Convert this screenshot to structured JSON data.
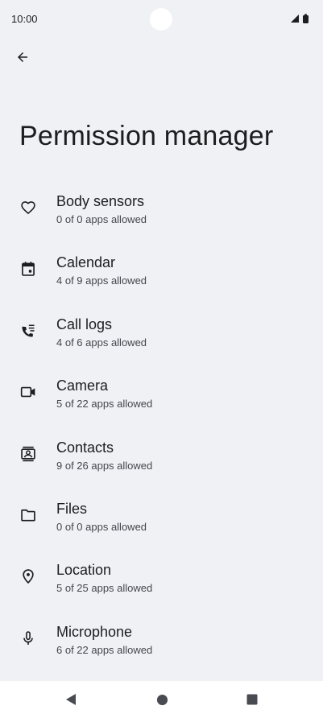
{
  "status_bar": {
    "time": "10:00"
  },
  "header": {
    "back_icon": "arrow-left-icon",
    "title": "Permission manager"
  },
  "permissions": [
    {
      "label": "Body sensors",
      "summary": "0 of 0 apps allowed",
      "icon": "heart-icon"
    },
    {
      "label": "Calendar",
      "summary": "4 of 9 apps allowed",
      "icon": "calendar-icon"
    },
    {
      "label": "Call logs",
      "summary": "4 of 6 apps allowed",
      "icon": "call-log-icon"
    },
    {
      "label": "Camera",
      "summary": "5 of 22 apps allowed",
      "icon": "camera-icon"
    },
    {
      "label": "Contacts",
      "summary": "9 of 26 apps allowed",
      "icon": "contacts-icon"
    },
    {
      "label": "Files",
      "summary": "0 of 0 apps allowed",
      "icon": "folder-icon"
    },
    {
      "label": "Location",
      "summary": "5 of 25 apps allowed",
      "icon": "location-pin-icon"
    },
    {
      "label": "Microphone",
      "summary": "6 of 22 apps allowed",
      "icon": "microphone-icon"
    }
  ],
  "nav_bar": {
    "back_icon": "triangle-back-icon",
    "home_icon": "circle-home-icon",
    "recents_icon": "square-recents-icon"
  },
  "colors": {
    "background": "#f0f1f4",
    "text": "#1d1d20",
    "secondary_text": "#45464d",
    "nav_background": "#ffffff"
  }
}
